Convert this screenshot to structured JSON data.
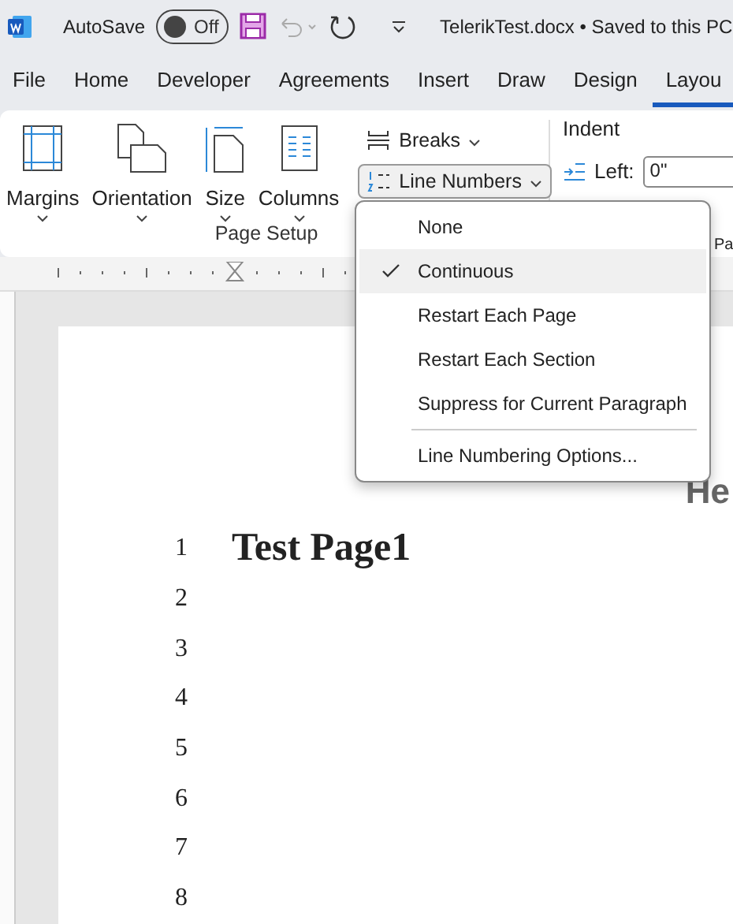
{
  "title_bar": {
    "autosave_label": "AutoSave",
    "autosave": {
      "on": false,
      "label": "Off"
    },
    "file_title": "TelerikTest.docx • Saved to this PC"
  },
  "tabs": [
    {
      "label": "File",
      "selected": false
    },
    {
      "label": "Home",
      "selected": false
    },
    {
      "label": "Developer",
      "selected": false
    },
    {
      "label": "Agreements",
      "selected": false
    },
    {
      "label": "Insert",
      "selected": false
    },
    {
      "label": "Draw",
      "selected": false
    },
    {
      "label": "Design",
      "selected": false
    },
    {
      "label": "Layou",
      "selected": true
    }
  ],
  "ribbon": {
    "page_setup": {
      "buttons": [
        {
          "kind": "margins",
          "label": "Margins"
        },
        {
          "kind": "orientation",
          "label": "Orientation"
        },
        {
          "kind": "size",
          "label": "Size"
        },
        {
          "kind": "columns",
          "label": "Columns"
        }
      ],
      "label": "Page Setup"
    },
    "breaks": "Breaks",
    "line_numbers": {
      "label": "Line Numbers",
      "expanded": true
    },
    "indent": {
      "title": "Indent",
      "left_label": "Left:",
      "left_value": "0\""
    },
    "paragraph_cut": "Pa"
  },
  "menu": {
    "items": [
      {
        "label": "None",
        "selected": false
      },
      {
        "label": "Continuous",
        "selected": true
      },
      {
        "label": "Restart Each Page",
        "selected": false
      },
      {
        "label": "Restart Each Section",
        "selected": false
      },
      {
        "label": "Suppress for Current Paragraph",
        "selected": false
      }
    ],
    "options": "Line Numbering Options..."
  },
  "document": {
    "heading_cut": "He",
    "title": "Test Page1",
    "line_numbers": [
      "1",
      "2",
      "3",
      "4",
      "5",
      "6",
      "7",
      "8"
    ]
  }
}
